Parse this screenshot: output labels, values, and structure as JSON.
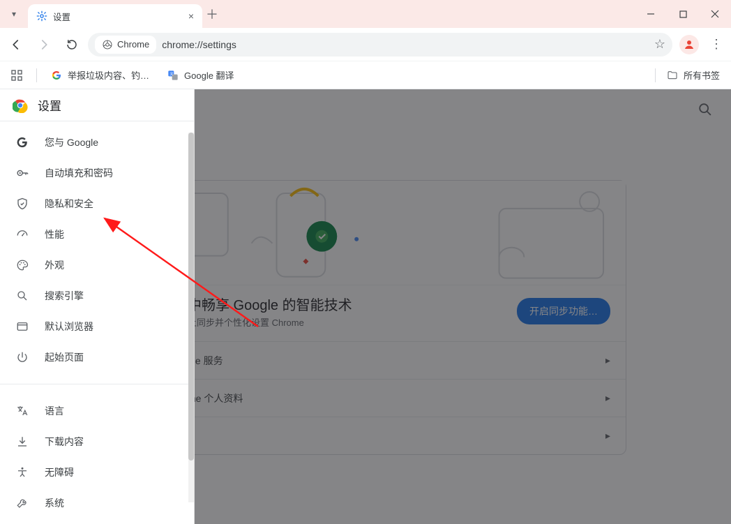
{
  "tab": {
    "title": "设置",
    "close": "×"
  },
  "toolbar": {
    "chip": "Chrome",
    "url": "chrome://settings"
  },
  "bookmarks": {
    "report": "举报垃圾内容、钓…",
    "translate": "Google 翻译",
    "all": "所有书签"
  },
  "sidebar": {
    "title": "设置",
    "items1": [
      {
        "label": "您与 Google"
      },
      {
        "label": "自动填充和密码"
      },
      {
        "label": "隐私和安全"
      },
      {
        "label": "性能"
      },
      {
        "label": "外观"
      },
      {
        "label": "搜索引擎"
      },
      {
        "label": "默认浏览器"
      },
      {
        "label": "起始页面"
      }
    ],
    "items2": [
      {
        "label": "语言"
      },
      {
        "label": "下载内容"
      },
      {
        "label": "无障碍"
      },
      {
        "label": "系统"
      }
    ]
  },
  "card": {
    "hero_h": "中畅享 Google 的智能技术",
    "hero_sub": "上同步并个性化设置 Chrome",
    "cta": "开启同步功能…",
    "row1": "gle 服务",
    "row2": "me 个人资料"
  }
}
